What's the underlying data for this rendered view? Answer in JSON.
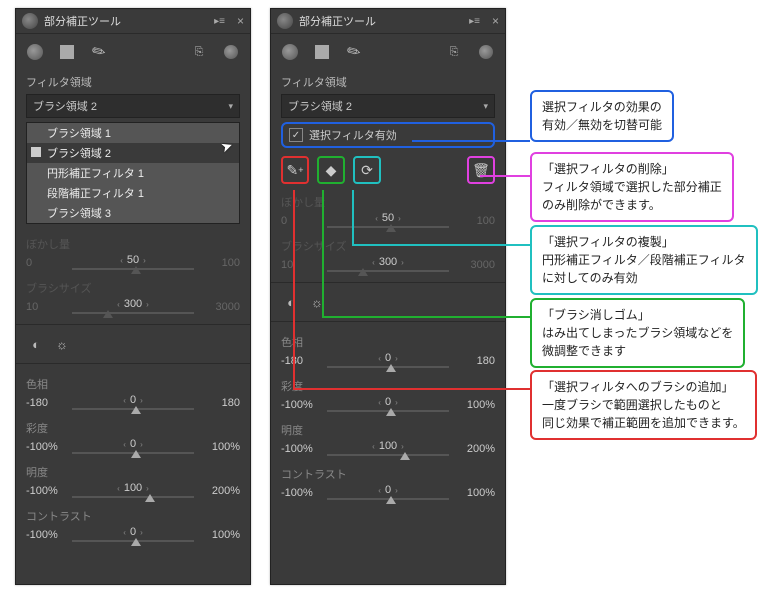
{
  "panel_title": "部分補正ツール",
  "section_filter_area": "フィルタ領域",
  "dropdown_selected": "ブラシ領域 2",
  "dropdown_items": {
    "i0": "ブラシ領域 1",
    "i1": "ブラシ領域 2",
    "i2": "円形補正フィルタ 1",
    "i3": "段階補正フィルタ 1",
    "i4": "ブラシ領域 3"
  },
  "checkbox_enable": "選択フィルタ有効",
  "blur_amount_label": "ぼかし量",
  "blur_values": {
    "left": "0",
    "center": "50",
    "right": "100"
  },
  "brush_size_label": "ブラシサイズ",
  "brush_values": {
    "left": "10",
    "center": "300",
    "right": "3000"
  },
  "hue_label": "色相",
  "hue_values": {
    "left": "-180",
    "center": "0",
    "right": "180"
  },
  "sat_label": "彩度",
  "sat_values": {
    "left": "-100%",
    "center": "0",
    "right": "100%"
  },
  "bri_label": "明度",
  "bri_values": {
    "left": "-100%",
    "center": "100",
    "right": "200%"
  },
  "con_label": "コントラスト",
  "con_values": {
    "left": "-100%",
    "center": "0",
    "right": "100%"
  },
  "callouts": {
    "blue": {
      "l1": "選択フィルタの効果の",
      "l2": "有効／無効を切替可能"
    },
    "magenta": {
      "l1": "「選択フィルタの削除」",
      "l2": "フィルタ領域で選択した部分補正",
      "l3": "のみ削除ができます。"
    },
    "cyan": {
      "l1": "「選択フィルタの複製」",
      "l2": "円形補正フィルタ／段階補正フィルタ",
      "l3": "に対してのみ有効"
    },
    "green": {
      "l1": "「ブラシ消しゴム」",
      "l2": "はみ出てしまったブラシ領域などを",
      "l3": "微調整できます"
    },
    "red": {
      "l1": "「選択フィルタへのブラシの追加」",
      "l2": "一度ブラシで範囲選択したものと",
      "l3": "同じ効果で補正範囲を追加できます。"
    }
  }
}
